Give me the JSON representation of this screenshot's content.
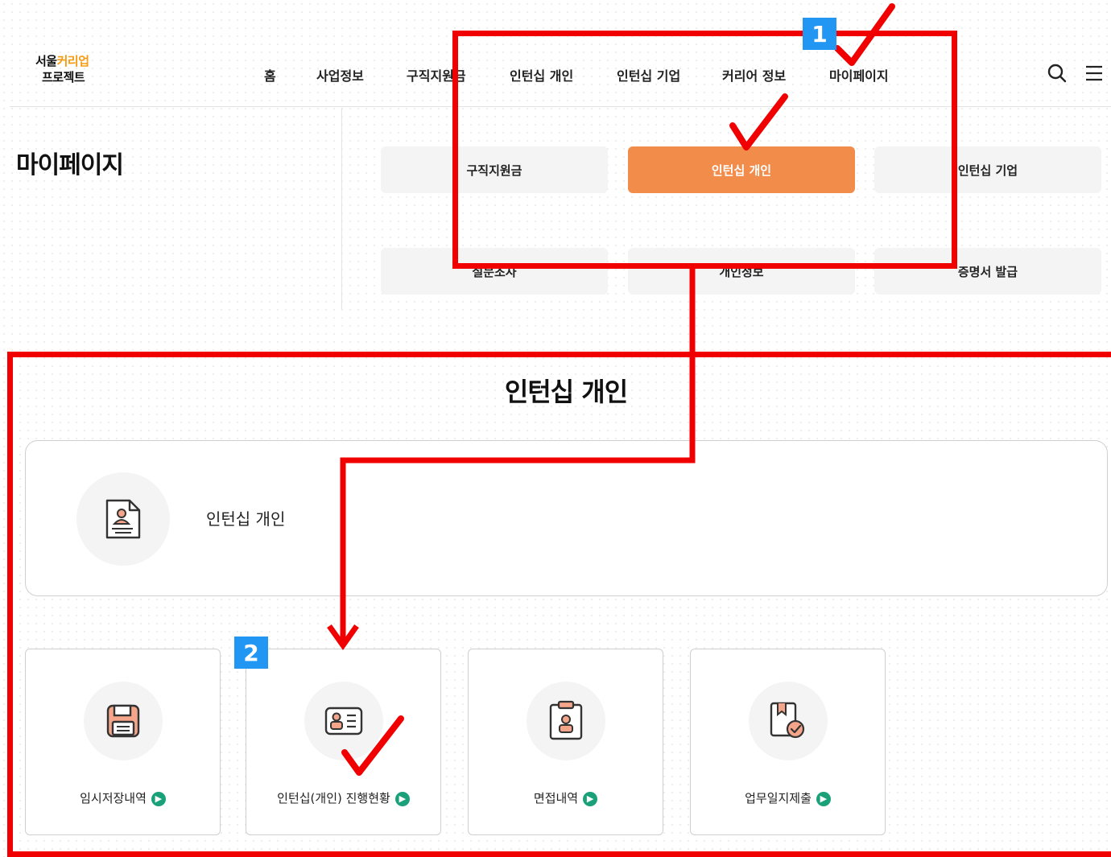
{
  "header": {
    "logo_line1_a": "서울",
    "logo_line1_b": "커리업",
    "logo_line2": "프로젝트",
    "nav": [
      "홈",
      "사업정보",
      "구직지원금",
      "인턴십 개인",
      "인턴십 기업",
      "커리어 정보",
      "마이페이지"
    ]
  },
  "sidebar": {
    "title": "마이페이지"
  },
  "submenu": {
    "items": [
      "구직지원금",
      "인턴십 개인",
      "인턴십 기업",
      "설문조사",
      "개인정보",
      "증명서 발급"
    ],
    "active": "인턴십 개인"
  },
  "section": {
    "title": "인턴십 개인",
    "hero_label": "인턴십 개인",
    "tiles": [
      {
        "label": "임시저장내역",
        "icon": "floppy-disk-icon"
      },
      {
        "label": "인턴십(개인) 진행현황",
        "icon": "id-card-icon"
      },
      {
        "label": "면접내역",
        "icon": "clipboard-user-icon"
      },
      {
        "label": "업무일지제출",
        "icon": "journal-check-icon"
      }
    ]
  },
  "annotations": {
    "badge1": "1",
    "badge2": "2"
  },
  "colors": {
    "accent": "#f28c4a",
    "annotation_red": "#f00000",
    "badge_blue": "#2196f3",
    "go_green": "#1aa179"
  }
}
